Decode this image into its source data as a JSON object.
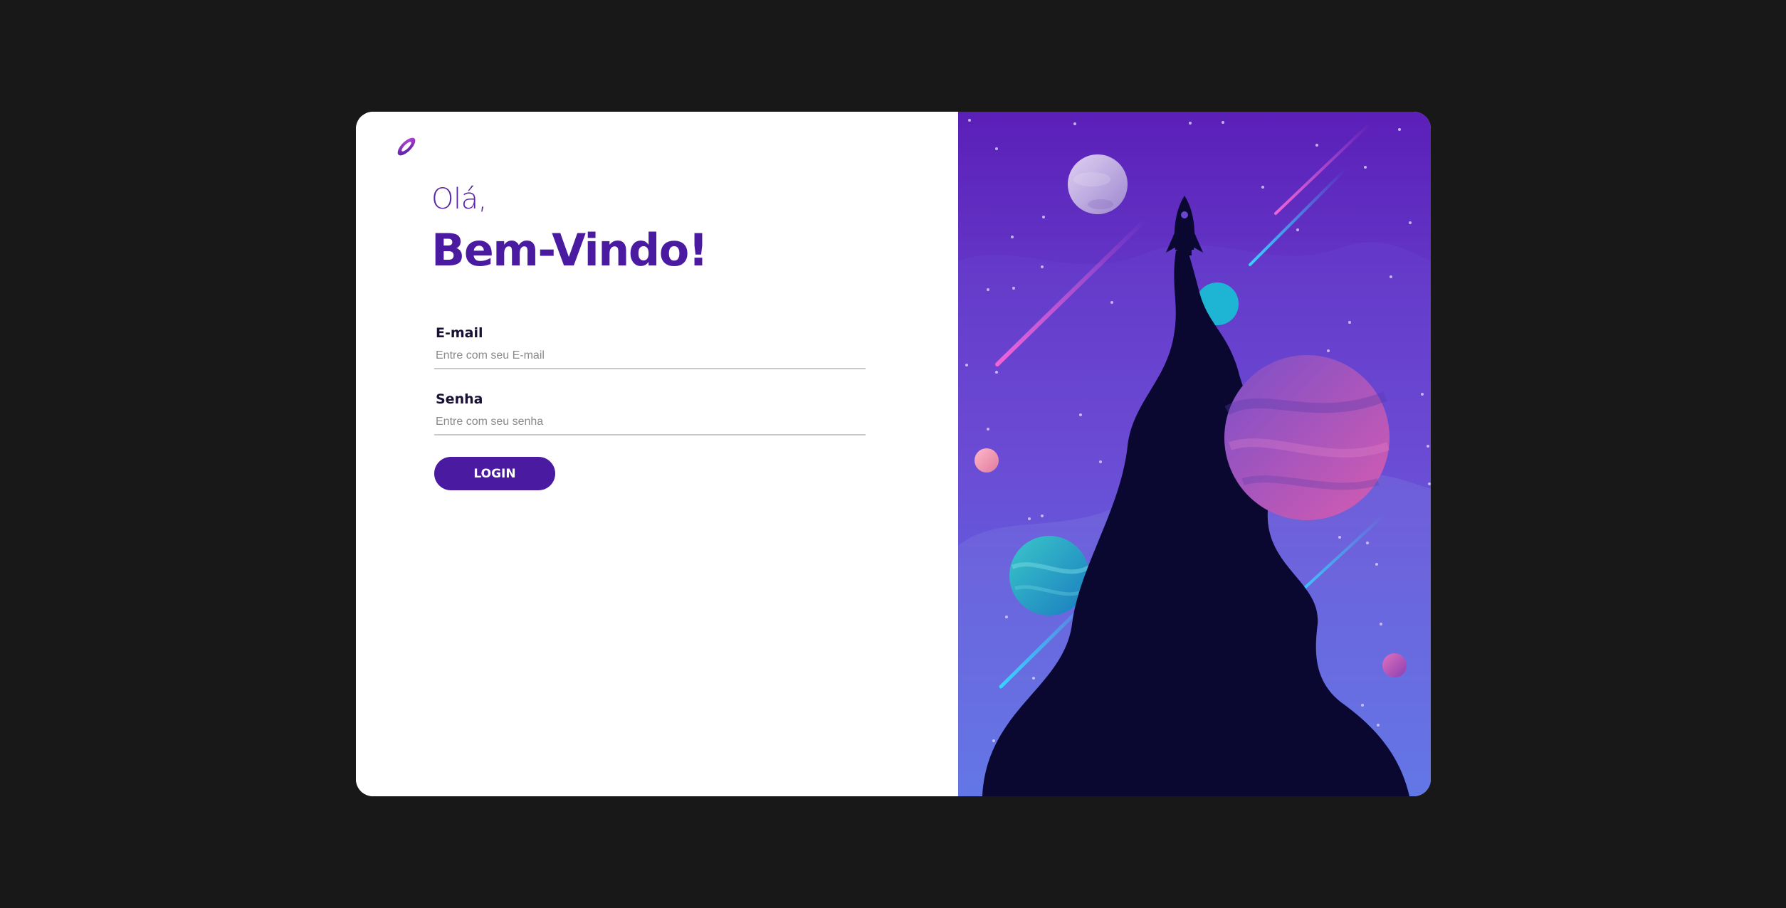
{
  "header": {
    "greeting": "Olá,",
    "welcome": "Bem-Vindo!",
    "logo_icon": "planet-ring-icon"
  },
  "form": {
    "email": {
      "label": "E-mail",
      "placeholder": "Entre com seu E-mail",
      "value": ""
    },
    "senha": {
      "label": "Senha",
      "placeholder": "Entre com seu senha",
      "value": ""
    },
    "login_label": "LOGIN"
  },
  "illustration": {
    "description_icon": "rocket-space-illustration"
  },
  "colors": {
    "background": "#181818",
    "accent": "#4a1aa0",
    "accent_light": "#5a25a8",
    "sky_top": "#5b1fb8",
    "sky_bottom": "#4d8ef5",
    "smoke": "#0a0830"
  }
}
